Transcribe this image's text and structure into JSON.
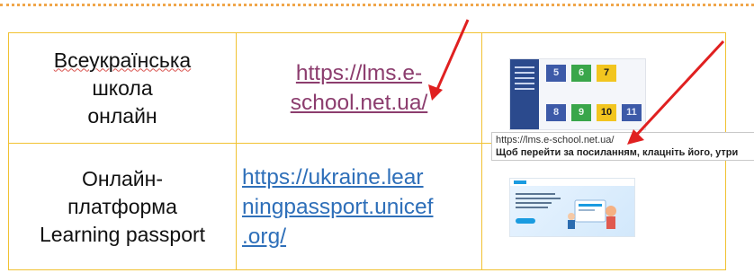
{
  "rows": [
    {
      "name_lines": [
        "Всеукраїнська",
        "школа",
        "онлайн"
      ],
      "link_lines": [
        "https://lms.e-",
        "school.net.ua/"
      ]
    },
    {
      "name_lines": [
        "Онлайн-",
        "платформа",
        "Learning passport"
      ],
      "link_lines": [
        "https://ukraine.lear",
        "ningpassport.unicef",
        ".org/"
      ]
    }
  ],
  "thumbnail1": {
    "tiles": [
      "5",
      "6",
      "7",
      "8",
      "9",
      "10",
      "11"
    ]
  },
  "tooltip": {
    "url": "https://lms.e-school.net.ua/",
    "hint": "Щоб перейти за посиланням, клацніть його, утри"
  },
  "colors": {
    "visited_link": "#8c3d6e",
    "link": "#2e6fb9",
    "table_border": "#f1c232",
    "arrow": "#e02020",
    "top_dotted": "#f0a64a"
  }
}
